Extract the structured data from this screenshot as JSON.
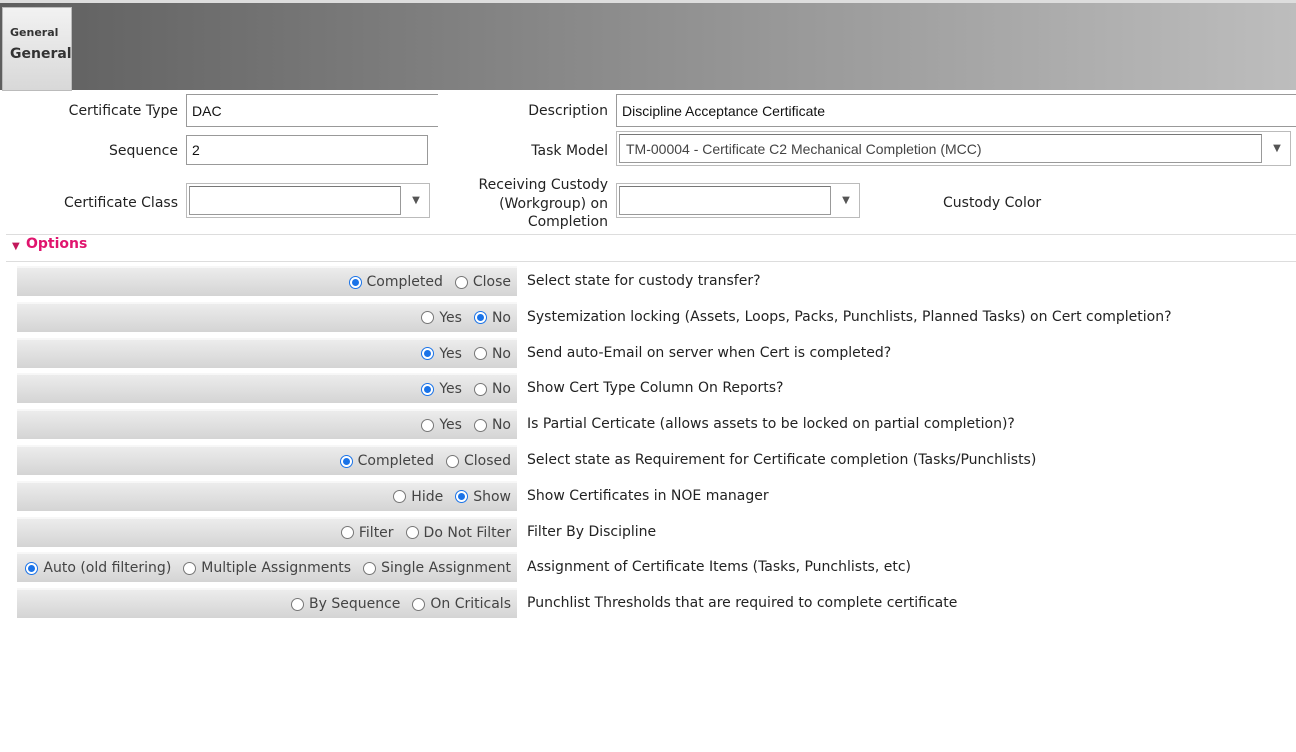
{
  "tab": {
    "small": "General",
    "label": "General"
  },
  "fields": {
    "certificate_type": {
      "label": "Certificate Type",
      "value": "DAC"
    },
    "description": {
      "label": "Description",
      "value": "Discipline Acceptance Certificate"
    },
    "sequence": {
      "label": "Sequence",
      "value": "2"
    },
    "task_model": {
      "label": "Task Model",
      "value": "TM-00004 - Certificate C2 Mechanical Completion (MCC)"
    },
    "certificate_class": {
      "label": "Certificate Class",
      "value": ""
    },
    "receiving_custody": {
      "label_lines": [
        "Receiving Custody",
        "(Workgroup) on",
        "Completion"
      ],
      "value": ""
    },
    "custody_color": {
      "label": "Custody Color"
    }
  },
  "options": {
    "title": "Options",
    "rows": [
      {
        "question": "Select state for custody transfer?",
        "choices": [
          "Completed",
          "Close"
        ],
        "selected": 0
      },
      {
        "question": "Systemization locking (Assets, Loops, Packs, Punchlists, Planned Tasks) on Cert completion?",
        "choices": [
          "Yes",
          "No"
        ],
        "selected": 1
      },
      {
        "question": "Send auto-Email on server when Cert is completed?",
        "choices": [
          "Yes",
          "No"
        ],
        "selected": 0
      },
      {
        "question": "Show Cert Type Column On Reports?",
        "choices": [
          "Yes",
          "No"
        ],
        "selected": 0
      },
      {
        "question": "Is Partial Certicate (allows assets to be locked on partial completion)?",
        "choices": [
          "Yes",
          "No"
        ],
        "selected": -1
      },
      {
        "question": "Select state as Requirement for Certificate completion (Tasks/Punchlists)",
        "choices": [
          "Completed",
          "Closed"
        ],
        "selected": 0
      },
      {
        "question": "Show Certificates in NOE manager",
        "choices": [
          "Hide",
          "Show"
        ],
        "selected": 1
      },
      {
        "question": "Filter By Discipline",
        "choices": [
          "Filter",
          "Do Not Filter"
        ],
        "selected": -1
      },
      {
        "question": "Assignment of Certificate Items (Tasks, Punchlists, etc)",
        "choices": [
          "Auto (old filtering)",
          "Multiple Assignments",
          "Single Assignment"
        ],
        "selected": 0
      },
      {
        "question": "Punchlist Thresholds that are required to complete certificate",
        "choices": [
          "By Sequence",
          "On Criticals"
        ],
        "selected": -1
      }
    ]
  },
  "colors": {
    "accent": "#e0156e",
    "radio": "#1a73e8"
  }
}
